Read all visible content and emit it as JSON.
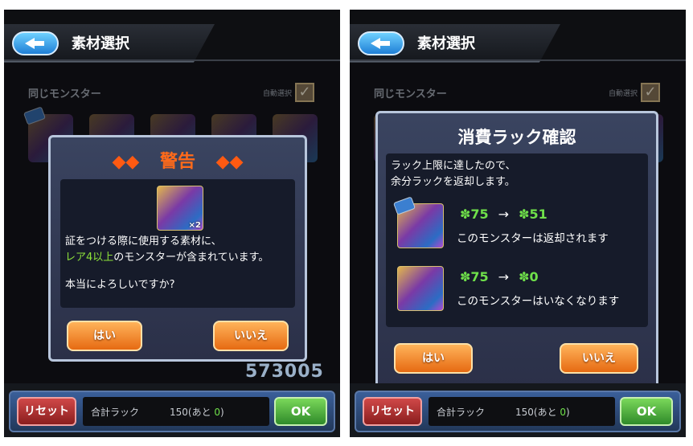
{
  "header": {
    "title": "素材選択"
  },
  "section": {
    "label": "同じモンスター",
    "auto_select_label": "自動選択",
    "auto_check": "✓"
  },
  "warning_dialog": {
    "title": "警告",
    "title_decor": "◆◆",
    "multiplier": "×2",
    "line1": "証をつける際に使用する素材に、",
    "line2_highlight": "レア4以上",
    "line2_rest": "のモンスターが含まれています。",
    "question": "本当によろしいですか?",
    "yes_label": "はい",
    "no_label": "いいえ"
  },
  "confirm_dialog": {
    "title": "消費ラック確認",
    "intro1": "ラック上限に達したので、",
    "intro2": "余分ラックを返却します。",
    "rows": [
      {
        "from": "✽75",
        "arrow": "→",
        "to": "✽51",
        "note": "このモンスターは返却されます"
      },
      {
        "from": "✽75",
        "arrow": "→",
        "to": "✽0",
        "note": "このモンスターはいなくなります"
      }
    ],
    "yes_label": "はい",
    "no_label": "いいえ"
  },
  "footer": {
    "reset_label": "リセット",
    "total_label": "合計ラック",
    "total_value": "150(あと ",
    "remaining": "0",
    "total_close": ")",
    "ok_label": "OK",
    "counter": "573005"
  },
  "colors": {
    "accent_orange": "#e66a12",
    "luck_green": "#6fe04a",
    "warning_text": "#ff6a1a"
  }
}
